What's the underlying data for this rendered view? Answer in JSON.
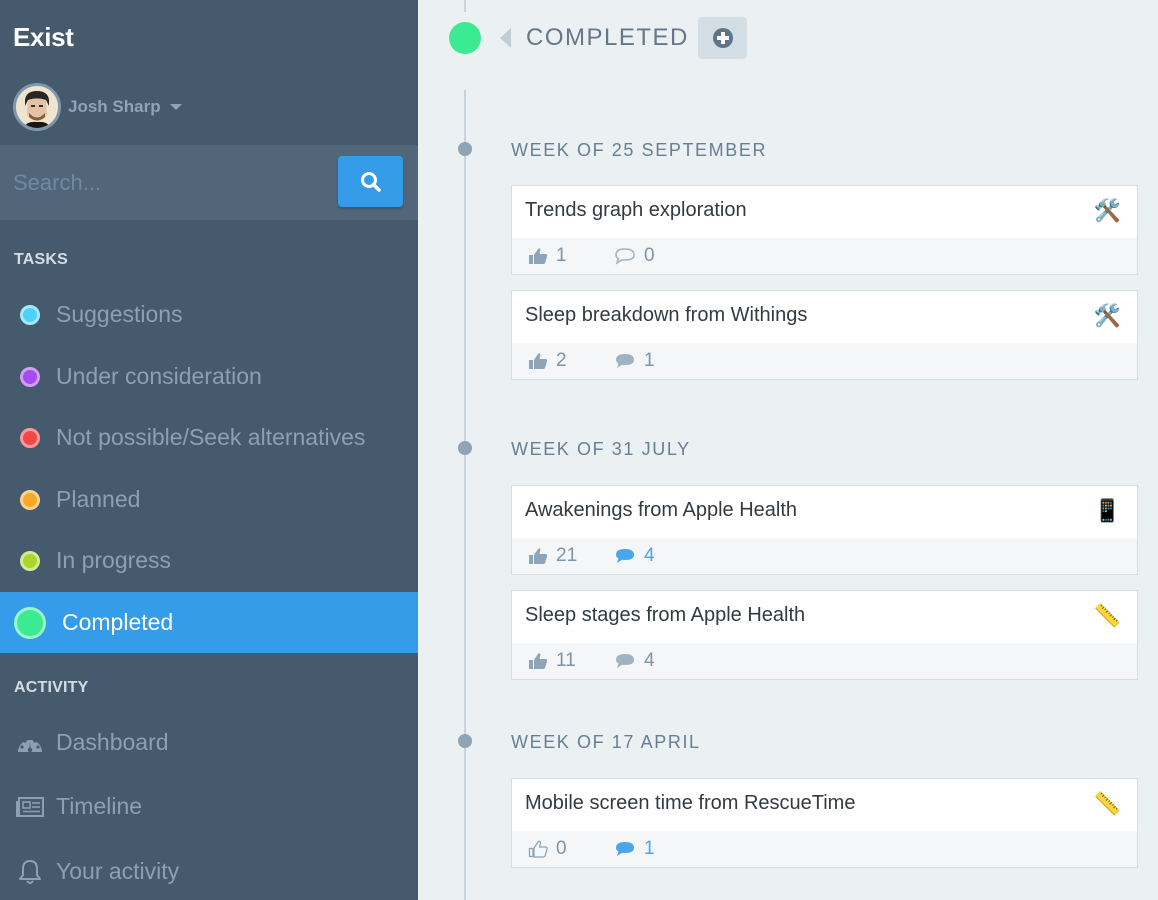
{
  "app": {
    "title": "Exist"
  },
  "user": {
    "name": "Josh Sharp"
  },
  "search": {
    "placeholder": "Search...",
    "value": ""
  },
  "sidebar": {
    "tasks_heading": "TASKS",
    "tasks": [
      {
        "label": "Suggestions",
        "color": "#4fd2f7",
        "ring": "#a4e8fb"
      },
      {
        "label": "Under consideration",
        "color": "#a64bf0",
        "ring": "#d39cf7"
      },
      {
        "label": "Not possible/Seek alternatives",
        "color": "#f24747",
        "ring": "#f89a9a"
      },
      {
        "label": "Planned",
        "color": "#f7a829",
        "ring": "#fbd28f"
      },
      {
        "label": "In progress",
        "color": "#a8d62a",
        "ring": "#d3ec94"
      },
      {
        "label": "Completed",
        "color": "#3aeb91",
        "ring": "#9df5c8",
        "active": true
      }
    ],
    "activity_heading": "ACTIVITY",
    "activity": [
      {
        "label": "Dashboard",
        "icon": "dashboard-icon"
      },
      {
        "label": "Timeline",
        "icon": "newspaper-icon"
      },
      {
        "label": "Your activity",
        "icon": "bell-icon"
      }
    ]
  },
  "main": {
    "status_title": "COMPLETED",
    "status_color": "#3aeb91",
    "weeks": [
      {
        "title": "WEEK OF 25 SEPTEMBER",
        "cards": [
          {
            "title": "Trends graph exploration",
            "emoji": "🛠️",
            "emoji_name": "tools-icon",
            "likes": "1",
            "comments": "0",
            "liked": true,
            "has_comments": false,
            "comments_active": false
          },
          {
            "title": "Sleep breakdown from Withings",
            "emoji": "🛠️",
            "emoji_name": "tools-icon",
            "likes": "2",
            "comments": "1",
            "liked": true,
            "has_comments": true,
            "comments_active": false
          }
        ]
      },
      {
        "title": "WEEK OF 31 JULY",
        "cards": [
          {
            "title": "Awakenings from Apple Health",
            "emoji": "📱",
            "emoji_name": "mobile-phone-icon",
            "likes": "21",
            "comments": "4",
            "liked": true,
            "has_comments": true,
            "comments_active": true
          },
          {
            "title": "Sleep stages from Apple Health",
            "emoji": "📏",
            "emoji_name": "ruler-icon",
            "likes": "11",
            "comments": "4",
            "liked": true,
            "has_comments": true,
            "comments_active": false
          }
        ]
      },
      {
        "title": "WEEK OF 17 APRIL",
        "cards": [
          {
            "title": "Mobile screen time from RescueTime",
            "emoji": "📏",
            "emoji_name": "ruler-icon",
            "likes": "0",
            "comments": "1",
            "liked": false,
            "has_comments": true,
            "comments_active": true
          }
        ]
      }
    ]
  }
}
